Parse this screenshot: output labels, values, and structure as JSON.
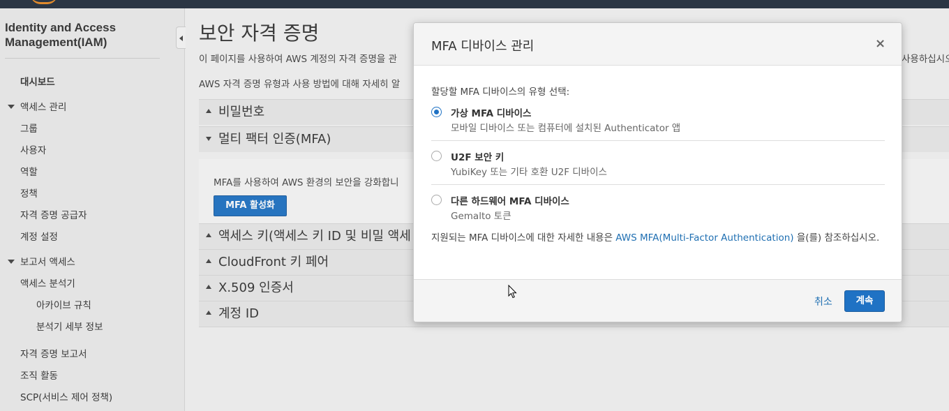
{
  "sidebar": {
    "title": "Identity and Access Management(IAM)",
    "dashboard": "대시보드",
    "access_management": "액세스 관리",
    "groups": "그룹",
    "users": "사용자",
    "roles": "역할",
    "policies": "정책",
    "identity_providers": "자격 증명 공급자",
    "account_settings": "계정 설정",
    "access_reports": "보고서 액세스",
    "access_analyzer": "액세스 분석기",
    "archive_rules": "아카이브 규칙",
    "analyzer_details": "분석기 세부 정보",
    "credential_report": "자격 증명 보고서",
    "org_activity": "조직 활동",
    "scp": "SCP(서비스 제어 정책)"
  },
  "main": {
    "title": "보안 자격 증명",
    "desc1": "이 페이지를 사용하여 AWS 계정의 자격 증명을 관",
    "desc1_tail": "사용하십시오",
    "desc2": "AWS 자격 증명 유형과 사용 방법에 대해 자세히 알",
    "sections": {
      "password": "비밀번호",
      "mfa": "멀티 팩터 인증(MFA)",
      "access_keys": "액세스 키(액세스 키 ID 및 비밀 액세",
      "cloudfront": "CloudFront 키 페어",
      "x509": "X.509 인증서",
      "account_id": "계정 ID"
    },
    "mfa_body": "MFA를 사용하여 AWS 환경의 보안을 강화합니",
    "mfa_button": "MFA 활성화"
  },
  "modal": {
    "title": "MFA 디바이스 관리",
    "close": "×",
    "prompt": "할당할 MFA 디바이스의 유형 선택:",
    "options": [
      {
        "label": "가상 MFA 디바이스",
        "sub": "모바일 디바이스 또는 컴퓨터에 설치된 Authenticator 앱",
        "checked": true
      },
      {
        "label": "U2F 보안 키",
        "sub": "YubiKey 또는 기타 호환 U2F 디바이스",
        "checked": false
      },
      {
        "label": "다른 하드웨어 MFA 디바이스",
        "sub": "Gemalto 토큰",
        "checked": false
      }
    ],
    "note_prefix": "지원되는 MFA 디바이스에 대한 자세한 내용은 ",
    "note_link": "AWS MFA(Multi-Factor Authentication)",
    "note_suffix": " 을(를) 참조하십시오.",
    "cancel": "취소",
    "continue": "계속"
  }
}
